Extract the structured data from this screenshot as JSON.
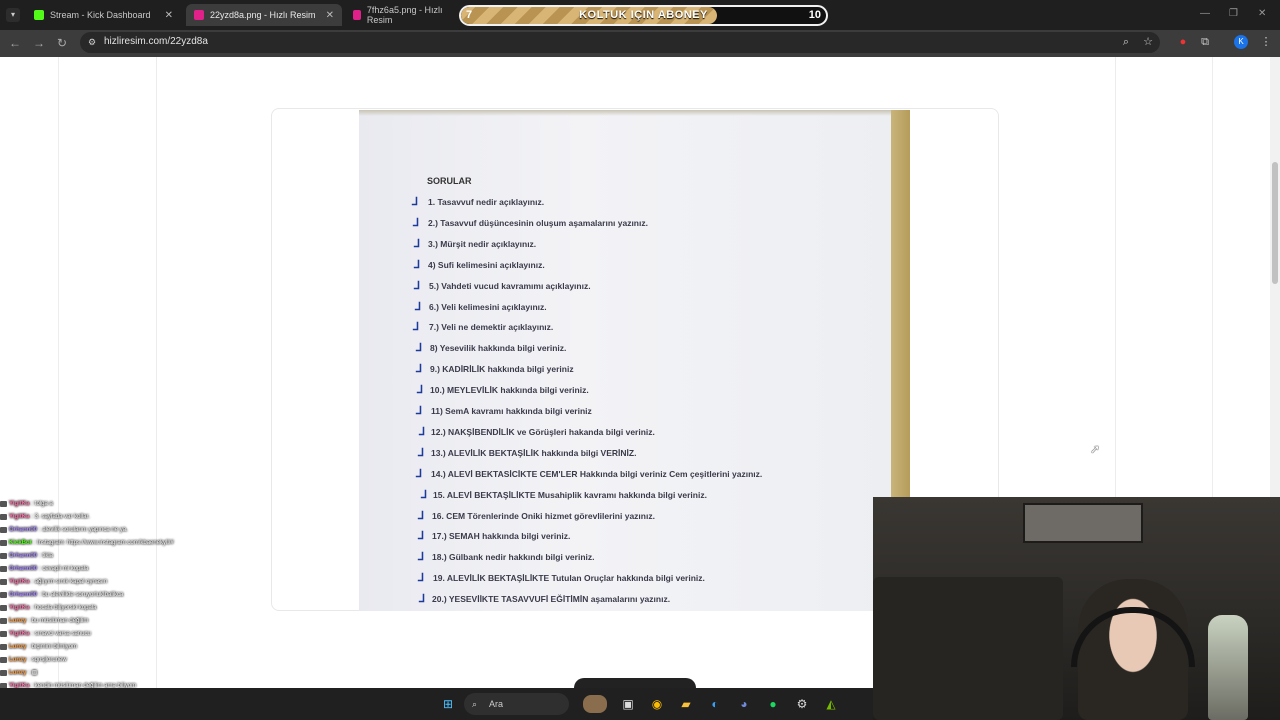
{
  "browser": {
    "tabs": [
      {
        "title": "Stream - Kick Dashboard",
        "favicon_color": "#53fc18",
        "active": false
      },
      {
        "title": "22yzd8a.png - Hızlı Resim",
        "favicon_color": "#e0218a",
        "active": true
      },
      {
        "title": "7fhz6a5.png - Hızlı Resim",
        "favicon_color": "#e0218a",
        "active": false
      }
    ],
    "close_glyph": "✕",
    "url": "hizliresim.com/22yzd8a"
  },
  "subgoal": {
    "label": "KOLTUK IÇIN ABONEY",
    "current": "7",
    "target": "10",
    "progress_fraction": 0.7
  },
  "document": {
    "title": "SORULAR",
    "questions": [
      "1. Tasavvuf nedir açıklayınız.",
      "2.) Tasavvuf düşüncesinin oluşum aşamalarını yazınız.",
      "3.) Mürşit nedir açıklayınız.",
      "4) Sufi kelimesini açıklayınız.",
      "5.) Vahdeti vucud kavramımı açıklayınız.",
      "6.) Veli kelimesini açıklayınız.",
      "7.) Veli ne demektir açıklayınız.",
      "8) Yesevilik hakkında bilgi veriniz.",
      "9.) KADİRİLİK hakkında bilgi yeriniz",
      "10.) MEYLEVİLİK hakkında bilgi veriniz.",
      "11) SemA kavramı hakkında bilgi veriniz",
      "12.) NAKŞİBENDİLİK ve Görüşleri hakanda bilgi veriniz.",
      "13.) ALEVİLİK BEKTAŞİLİK hakkında bilgi VERİNİZ.",
      "14.) ALEVİ BEKTASİCİKTE CEM'LER Hakkında bilgi veriniz Cem çeşitlerini yazınız.",
      "15. ALEVİ BEKTAŞİLİKTE Musahiplik kavramı hakkında bilgi veriniz.",
      "16. CEM Törenlerinde Oniki hizmet görevlilerini yazınız.",
      "17.) SEMAH hakkında bilgi veriniz.",
      "18.) Gülbank nedir hakkındı bilgi veriniz.",
      "19. ALEVİLİK BEKTAŞİLİKTE Tutulan Oruçlar hakkında bilgi veriniz.",
      "20.) YESEVİİKTE TASAVVUFİ EĞİTİMİN aşamalarını yazınız."
    ]
  },
  "chat": [
    {
      "user": "YigitKa",
      "color": "#ff6fa8",
      "msg": ": tolga a"
    },
    {
      "user": "YigitKa",
      "color": "#ff6fa8",
      "msg": ": 3. sayfada var kollar."
    },
    {
      "user": "Orhann00",
      "color": "#a98bff",
      "msg": ": alevilik sorularını yapınca ne ya."
    },
    {
      "user": "KickBot",
      "color": "#53fc18",
      "msg": ": Instagram: https://www.instagram.com/kbaenekyll/#"
    },
    {
      "user": "Orhann00",
      "color": "#a98bff",
      "msg": ": tikla"
    },
    {
      "user": "Orhann00",
      "color": "#a98bff",
      "msg": ": cevapli mi kopala"
    },
    {
      "user": "YigitKa",
      "color": "#ff6fa8",
      "msg": ": ağlıyım sınık kapal oynasın"
    },
    {
      "user": "Orhann00",
      "color": "#a98bff",
      "msg": ": bu alevilikte soruyorluk!balikca"
    },
    {
      "user": "YigitKa",
      "color": "#ff6fa8",
      "msg": ": hocala biliyorski kopala"
    },
    {
      "user": "Lunzy",
      "color": "#ff9a3c",
      "msg": ": bu müslüman değilim"
    },
    {
      "user": "YigitKa",
      "color": "#ff6fa8",
      "msg": ": sınavci varsa sanucu"
    },
    {
      "user": "Lunzy",
      "color": "#ff9a3c",
      "msg": ": biçimini bilmiyom"
    },
    {
      "user": "Lunzy",
      "color": "#ff9a3c",
      "msg": ": sqnsjlorunew"
    },
    {
      "user": "Lunzy",
      "color": "#ff9a3c",
      "msg": ": ▩"
    },
    {
      "user": "YigitKa",
      "color": "#ff6fa8",
      "msg": ": kendin müslüman değilim ama biliyom"
    },
    {
      "user": "",
      "color": "#ffffff",
      "msg": "geçen sınavda sordu çünkü"
    },
    {
      "user": "Orhann00",
      "color": "#a98bff",
      "msg": ": çek beni"
    }
  ],
  "taskbar": {
    "search_placeholder": "Ara",
    "apps": [
      "windows-start",
      "task-view",
      "chrome",
      "file-explorer",
      "edge",
      "discord",
      "spotify",
      "steam",
      "nvidia"
    ]
  }
}
